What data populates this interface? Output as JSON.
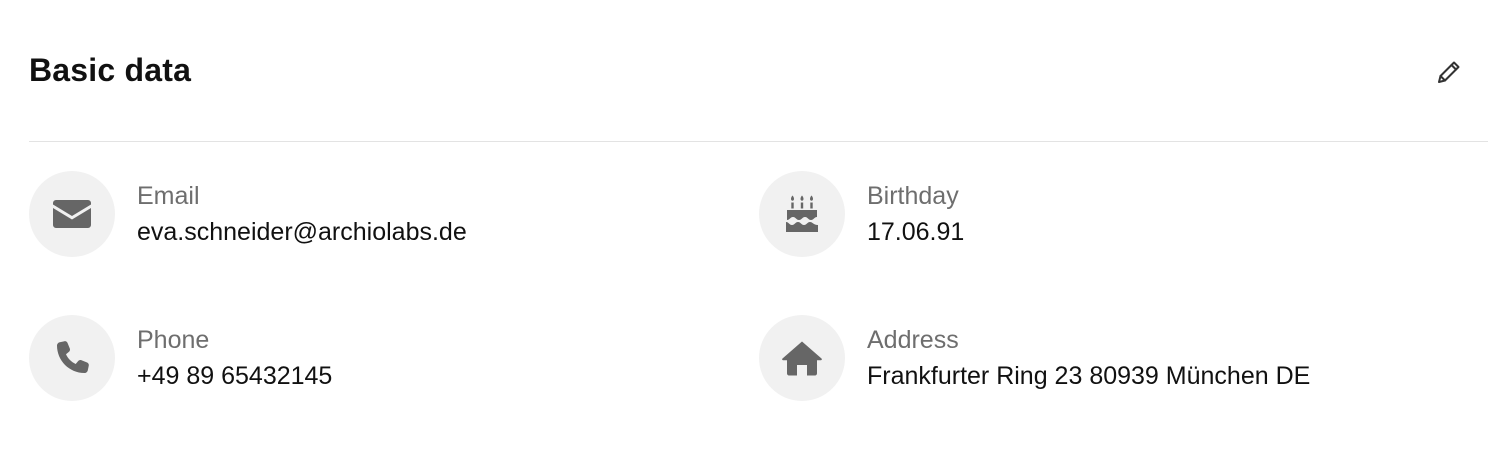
{
  "header": {
    "title": "Basic data",
    "edit_icon": "pencil-icon"
  },
  "fields": {
    "email": {
      "icon": "envelope-icon",
      "label": "Email",
      "value": "eva.schneider@archiolabs.de"
    },
    "birthday": {
      "icon": "birthday-cake-icon",
      "label": "Birthday",
      "value": "17.06.91"
    },
    "phone": {
      "icon": "phone-icon",
      "label": "Phone",
      "value": "+49 89 65432145"
    },
    "address": {
      "icon": "home-icon",
      "label": "Address",
      "value": "Frankfurter Ring 23 80939 München DE"
    }
  },
  "colors": {
    "icon": "#666666",
    "icon_circle": "#f1f1f1",
    "label": "#6e6e6e",
    "value": "#111111",
    "divider": "#e3e3e3"
  }
}
